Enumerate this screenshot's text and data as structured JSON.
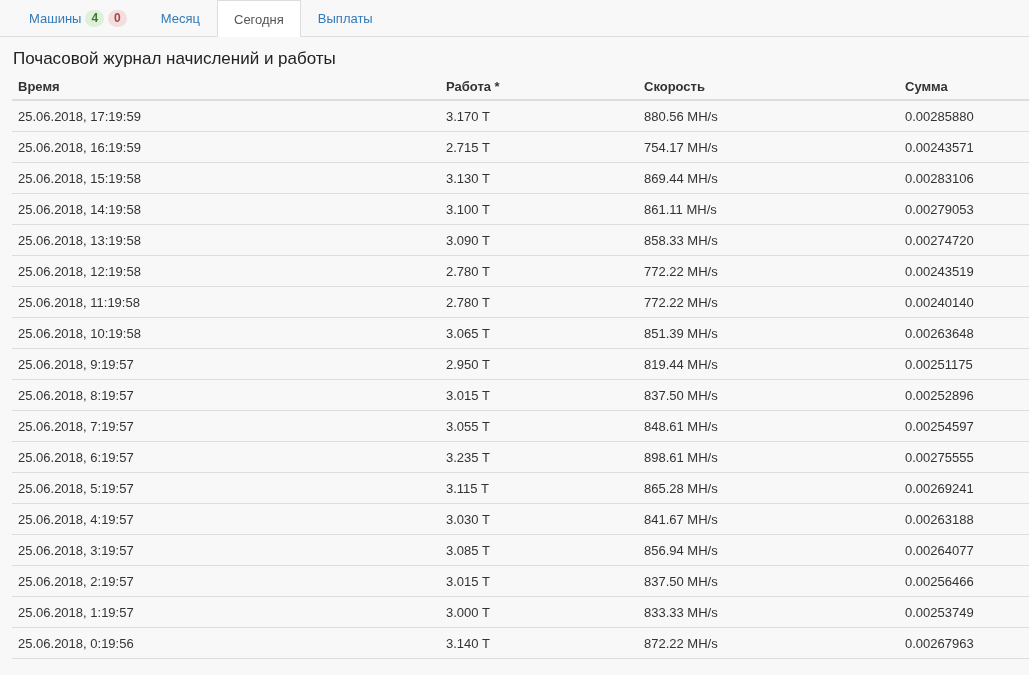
{
  "tabs": [
    {
      "label": "Машины",
      "selected": false,
      "badges": [
        {
          "text": "4",
          "kind": "success"
        },
        {
          "text": "0",
          "kind": "danger"
        }
      ]
    },
    {
      "label": "Месяц",
      "selected": false
    },
    {
      "label": "Сегодня",
      "selected": true
    },
    {
      "label": "Выплаты",
      "selected": false
    }
  ],
  "title": "Почасовой журнал начислений и работы",
  "table": {
    "columns": [
      "Время",
      "Работа *",
      "Скорость",
      "Сумма"
    ],
    "rows": [
      [
        "25.06.2018, 17:19:59",
        "3.170 T",
        "880.56 MH/s",
        "0.00285880"
      ],
      [
        "25.06.2018, 16:19:59",
        "2.715 T",
        "754.17 MH/s",
        "0.00243571"
      ],
      [
        "25.06.2018, 15:19:58",
        "3.130 T",
        "869.44 MH/s",
        "0.00283106"
      ],
      [
        "25.06.2018, 14:19:58",
        "3.100 T",
        "861.11 MH/s",
        "0.00279053"
      ],
      [
        "25.06.2018, 13:19:58",
        "3.090 T",
        "858.33 MH/s",
        "0.00274720"
      ],
      [
        "25.06.2018, 12:19:58",
        "2.780 T",
        "772.22 MH/s",
        "0.00243519"
      ],
      [
        "25.06.2018, 11:19:58",
        "2.780 T",
        "772.22 MH/s",
        "0.00240140"
      ],
      [
        "25.06.2018, 10:19:58",
        "3.065 T",
        "851.39 MH/s",
        "0.00263648"
      ],
      [
        "25.06.2018, 9:19:57",
        "2.950 T",
        "819.44 MH/s",
        "0.00251175"
      ],
      [
        "25.06.2018, 8:19:57",
        "3.015 T",
        "837.50 MH/s",
        "0.00252896"
      ],
      [
        "25.06.2018, 7:19:57",
        "3.055 T",
        "848.61 MH/s",
        "0.00254597"
      ],
      [
        "25.06.2018, 6:19:57",
        "3.235 T",
        "898.61 MH/s",
        "0.00275555"
      ],
      [
        "25.06.2018, 5:19:57",
        "3.115 T",
        "865.28 MH/s",
        "0.00269241"
      ],
      [
        "25.06.2018, 4:19:57",
        "3.030 T",
        "841.67 MH/s",
        "0.00263188"
      ],
      [
        "25.06.2018, 3:19:57",
        "3.085 T",
        "856.94 MH/s",
        "0.00264077"
      ],
      [
        "25.06.2018, 2:19:57",
        "3.015 T",
        "837.50 MH/s",
        "0.00256466"
      ],
      [
        "25.06.2018, 1:19:57",
        "3.000 T",
        "833.33 MH/s",
        "0.00253749"
      ],
      [
        "25.06.2018, 0:19:56",
        "3.140 T",
        "872.22 MH/s",
        "0.00267963"
      ]
    ]
  }
}
